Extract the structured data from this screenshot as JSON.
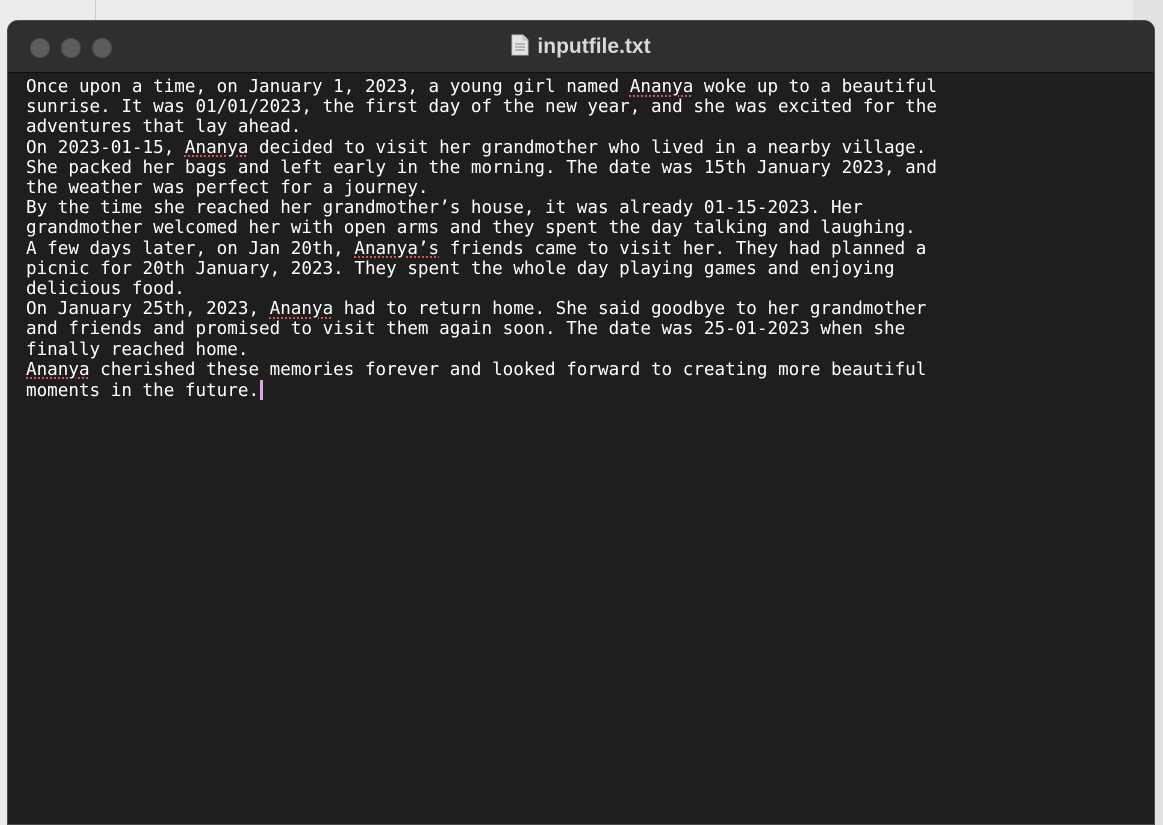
{
  "window": {
    "title": "inputfile.txt",
    "icons": {
      "file": "document-icon",
      "close": "close-button",
      "minimize": "minimize-button",
      "zoom": "zoom-button"
    },
    "colors": {
      "background": "#1e1e1e",
      "titlebar": "#2f2f2f",
      "text": "#ffffff",
      "spellcheck": "#d9534f",
      "caret": "#e0a3e0"
    }
  },
  "editor": {
    "lines": [
      [
        {
          "t": "Once upon a time, on January 1, 2023, a young girl named "
        },
        {
          "t": "Ananya",
          "s": true
        },
        {
          "t": " woke up to a beautiful"
        }
      ],
      [
        {
          "t": "sunrise. It was 01/01/2023, the first day of the new year, and she was excited for the"
        }
      ],
      [
        {
          "t": "adventures that lay ahead."
        }
      ],
      [
        {
          "t": "On 2023-01-15, "
        },
        {
          "t": "Ananya",
          "s": true
        },
        {
          "t": " decided to visit her grandmother who lived in a nearby village."
        }
      ],
      [
        {
          "t": "She packed her bags and left early in the morning. The date was 15th January 2023, and"
        }
      ],
      [
        {
          "t": "the weather was perfect for a journey."
        }
      ],
      [
        {
          "t": "By the time she reached her grandmother’s house, it was already 01-15-2023. Her"
        }
      ],
      [
        {
          "t": "grandmother welcomed her with open arms and they spent the day talking and laughing."
        }
      ],
      [
        {
          "t": "A few days later, on Jan 20th, "
        },
        {
          "t": "Ananya’s",
          "s": true
        },
        {
          "t": " friends came to visit her. They had planned a"
        }
      ],
      [
        {
          "t": "picnic for 20th January, 2023. They spent the whole day playing games and enjoying"
        }
      ],
      [
        {
          "t": "delicious food."
        }
      ],
      [
        {
          "t": "On January 25th, 2023, "
        },
        {
          "t": "Ananya",
          "s": true
        },
        {
          "t": " had to return home. She said goodbye to her grandmother"
        }
      ],
      [
        {
          "t": "and friends and promised to visit them again soon. The date was 25-01-2023 when she"
        }
      ],
      [
        {
          "t": "finally reached home."
        }
      ],
      [
        {
          "t": "Ananya",
          "s": true
        },
        {
          "t": " cherished these memories forever and looked forward to creating more beautiful"
        }
      ],
      [
        {
          "t": "moments in the future."
        }
      ]
    ]
  }
}
